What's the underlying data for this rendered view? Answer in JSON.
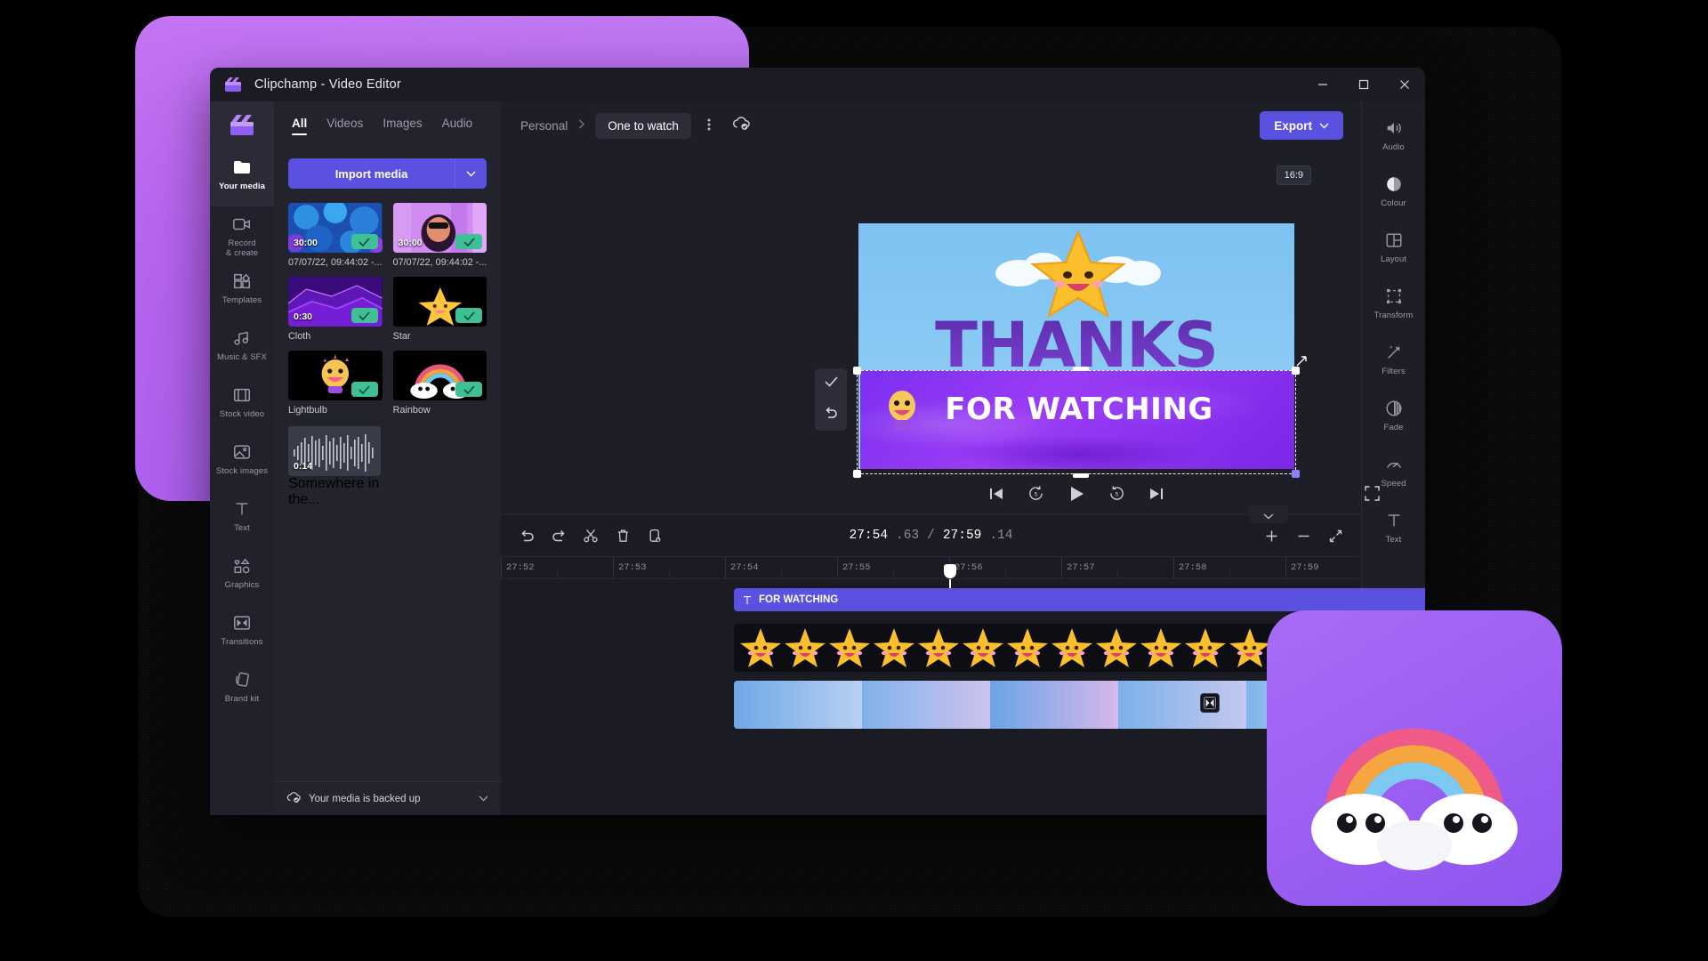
{
  "window": {
    "title": "Clipchamp - Video Editor",
    "logo_icon": "clapperboard-icon",
    "minimize": "─",
    "maximize": "☐",
    "close": "✕"
  },
  "left_rail": {
    "logo_icon": "clipchamp-logo-icon",
    "items": [
      {
        "label": "Your media",
        "icon": "folder-icon",
        "active": true
      },
      {
        "label": "Record\n& create",
        "icon": "video-camera-icon",
        "active": false
      },
      {
        "label": "Templates",
        "icon": "templates-icon",
        "active": false
      },
      {
        "label": "Music & SFX",
        "icon": "music-note-icon",
        "active": false
      },
      {
        "label": "Stock video",
        "icon": "film-strip-icon",
        "active": false
      },
      {
        "label": "Stock images",
        "icon": "image-icon",
        "active": false
      },
      {
        "label": "Text",
        "icon": "text-t-icon",
        "active": false
      },
      {
        "label": "Graphics",
        "icon": "shapes-icon",
        "active": false
      },
      {
        "label": "Transitions",
        "icon": "transition-icon",
        "active": false
      },
      {
        "label": "Brand kit",
        "icon": "brand-kit-icon",
        "active": false
      }
    ]
  },
  "media_panel": {
    "tabs": [
      {
        "label": "All",
        "active": true
      },
      {
        "label": "Videos",
        "active": false
      },
      {
        "label": "Images",
        "active": false
      },
      {
        "label": "Audio",
        "active": false
      }
    ],
    "import_label": "Import media",
    "import_caret_icon": "chevron-down-icon",
    "items": [
      {
        "caption": "07/07/22, 09:44:02 -...",
        "duration": "30:00",
        "checked": true,
        "kind": "video-blue-bubbles"
      },
      {
        "caption": "07/07/22, 09:44:02 -...",
        "duration": "30:00",
        "checked": true,
        "kind": "video-pink-person"
      },
      {
        "caption": "Cloth",
        "duration": "0:30",
        "checked": true,
        "kind": "video-purple-cloth"
      },
      {
        "caption": "Star",
        "duration": "",
        "checked": true,
        "kind": "image-star"
      },
      {
        "caption": "Lightbulb",
        "duration": "",
        "checked": true,
        "kind": "image-lightbulb"
      },
      {
        "caption": "Rainbow",
        "duration": "",
        "checked": true,
        "kind": "image-rainbow"
      }
    ],
    "audio_item": {
      "caption": "Somewhere in the...",
      "duration": "0:14",
      "kind": "audio-waveform"
    },
    "backup_text": "Your media is backed up",
    "backup_icon": "cloud-check-icon",
    "backup_chevron_icon": "chevron-down-icon"
  },
  "topbar": {
    "breadcrumb_root": "Personal",
    "breadcrumb_sep_icon": "chevron-right-icon",
    "project_name": "One to watch",
    "kebab_icon": "more-vertical-icon",
    "cloud_icon": "cloud-check-icon",
    "export_label": "Export",
    "export_caret_icon": "chevron-down-icon"
  },
  "preview": {
    "aspect_ratio": "16:9",
    "title_text": "THANKS",
    "subtitle_text": "FOR WATCHING",
    "accept_icon": "check-icon",
    "undo_icon": "undo-arrow-icon",
    "resize_handle_icon": "resize-diagonal-icon",
    "controls": [
      {
        "name": "skip-to-start-button",
        "icon": "skip-back-icon"
      },
      {
        "name": "rewind-5s-button",
        "icon": "rewind-5-icon"
      },
      {
        "name": "play-button",
        "icon": "play-icon"
      },
      {
        "name": "forward-5s-button",
        "icon": "forward-5-icon"
      },
      {
        "name": "skip-to-end-button",
        "icon": "skip-forward-icon"
      }
    ],
    "fullscreen_icon": "fullscreen-icon"
  },
  "timeline": {
    "tools": [
      {
        "name": "undo-button",
        "icon": "undo-icon"
      },
      {
        "name": "redo-button",
        "icon": "redo-icon"
      },
      {
        "name": "split-button",
        "icon": "scissors-icon"
      },
      {
        "name": "delete-button",
        "icon": "trash-icon"
      },
      {
        "name": "duplicate-button",
        "icon": "duplicate-icon"
      }
    ],
    "current_time_main": "27:54",
    "current_time_frac": ".63",
    "time_separator": "/",
    "total_time_main": "27:59",
    "total_time_frac": ".14",
    "zoom_in_icon": "plus-icon",
    "zoom_out_icon": "minus-icon",
    "fit_icon": "fit-to-screen-icon",
    "collapse_icon": "chevron-down-icon",
    "ruler_ticks": [
      "27:52",
      "27:53",
      "27:54",
      "27:55",
      "27:56",
      "27:57",
      "27:58",
      "27:59"
    ],
    "clips": [
      {
        "name": "text-clip",
        "label": "FOR WATCHING",
        "icon": "text-t-icon",
        "type": "text"
      },
      {
        "name": "star-clip",
        "label": "",
        "type": "image-star-strip"
      },
      {
        "name": "video-clip",
        "label": "",
        "type": "video-gradient-strip"
      }
    ],
    "transition_icon": "transition-icon"
  },
  "right_rail": {
    "items": [
      {
        "label": "Audio",
        "icon": "speaker-icon"
      },
      {
        "label": "Colour",
        "icon": "contrast-circle-icon"
      },
      {
        "label": "Layout",
        "icon": "layout-grid-icon"
      },
      {
        "label": "Transform",
        "icon": "transform-icon"
      },
      {
        "label": "Filters",
        "icon": "magic-wand-icon"
      },
      {
        "label": "Fade",
        "icon": "fade-circle-icon"
      },
      {
        "label": "Speed",
        "icon": "speedometer-icon"
      },
      {
        "label": "Text",
        "icon": "text-t-icon"
      }
    ],
    "collapse_icon": "chevron-left-icon"
  },
  "colors": {
    "accent": "#5b51e0",
    "panel": "#22232d",
    "window": "#1d1e26",
    "ok_green": "#3fbf96",
    "card_purple": "#a75cec"
  }
}
